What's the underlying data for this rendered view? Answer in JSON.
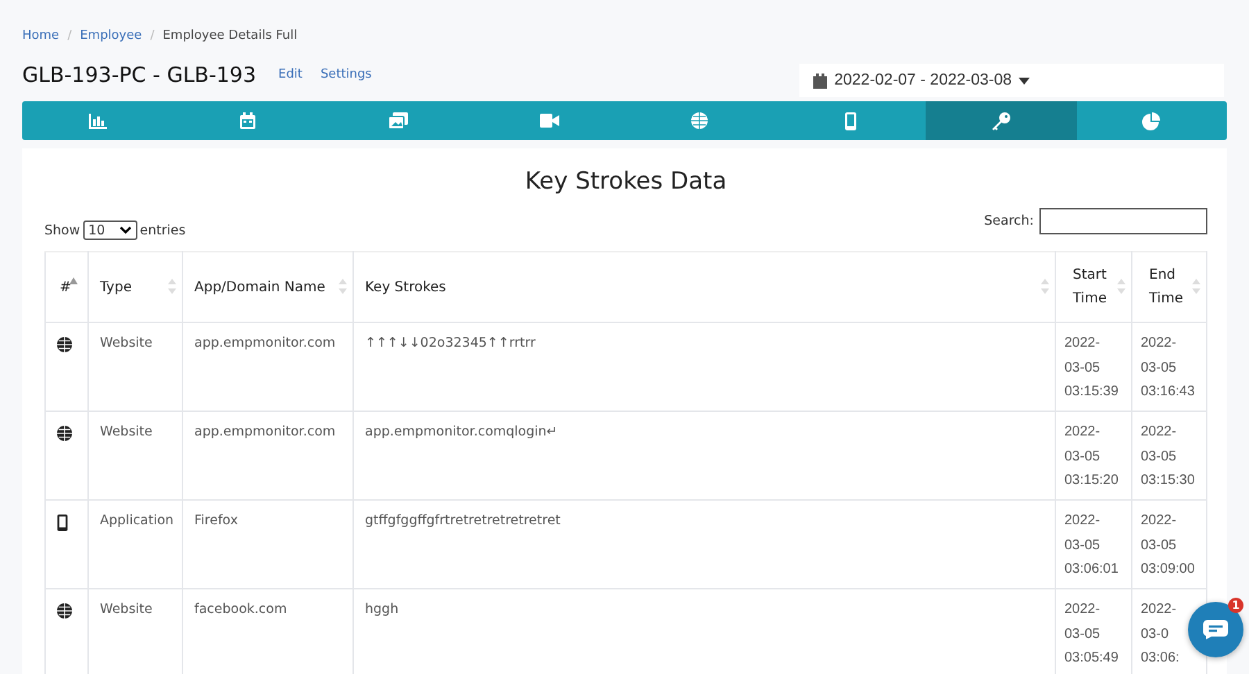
{
  "breadcrumb": [
    {
      "kind": "link",
      "label": "Home"
    },
    {
      "kind": "separator",
      "label": "/"
    },
    {
      "kind": "link",
      "label": "Employee"
    },
    {
      "kind": "separator",
      "label": "/"
    },
    {
      "kind": "current",
      "label": "Employee Details Full"
    }
  ],
  "title": "GLB-193-PC - GLB-193",
  "title_links": [
    "Edit",
    "Settings"
  ],
  "date_range": "2022-02-07 - 2022-03-08",
  "tabs": [
    {
      "kind": "chart",
      "selected": false
    },
    {
      "kind": "calendar",
      "selected": false
    },
    {
      "kind": "images",
      "selected": false
    },
    {
      "kind": "video",
      "selected": false
    },
    {
      "kind": "globe",
      "selected": false
    },
    {
      "kind": "mobile",
      "selected": false
    },
    {
      "kind": "key",
      "selected": true
    },
    {
      "kind": "pie",
      "selected": false
    }
  ],
  "heading": "Key Strokes Data",
  "length": {
    "before": "Show",
    "value": "10",
    "after": "entries"
  },
  "search": {
    "label": "Search:"
  },
  "columns": [
    {
      "label": "#",
      "sorted": true
    },
    {
      "label": "Type",
      "sorted": false
    },
    {
      "label": "App/Domain Name",
      "sorted": false
    },
    {
      "label": "Key Strokes",
      "sorted": false
    },
    {
      "label": "Start Time",
      "sorted": false
    },
    {
      "label": "End Time",
      "sorted": false
    }
  ],
  "rows": [
    {
      "kind": "website",
      "type": "Website",
      "name": "app.empmonitor.com",
      "keys": "↑↑↑↓↓02o32345↑↑rrtrr",
      "start": [
        "2022-",
        "03-05",
        "03:15:39"
      ],
      "end": [
        "2022-",
        "03-05",
        "03:16:43"
      ]
    },
    {
      "kind": "website",
      "type": "Website",
      "name": "app.empmonitor.com",
      "keys": "app.empmonitor.comqlogin↵",
      "start": [
        "2022-",
        "03-05",
        "03:15:20"
      ],
      "end": [
        "2022-",
        "03-05",
        "03:15:30"
      ]
    },
    {
      "kind": "application",
      "type": "Application",
      "name": "Firefox",
      "keys": "gtffgfggffgfrtretretretretretret",
      "start": [
        "2022-",
        "03-05",
        "03:06:01"
      ],
      "end": [
        "2022-",
        "03-05",
        "03:09:00"
      ]
    },
    {
      "kind": "website",
      "type": "Website",
      "name": "facebook.com",
      "keys": "hggh",
      "start": [
        "2022-",
        "03-05",
        "03:05:49"
      ],
      "end": [
        "2022-",
        "03-0",
        "03:06:"
      ]
    }
  ],
  "chat": {
    "badge": "1"
  }
}
